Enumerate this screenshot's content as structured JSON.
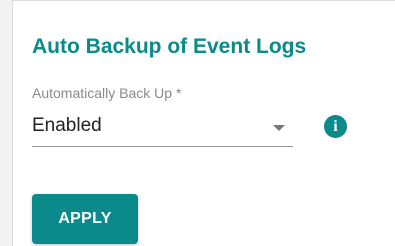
{
  "section": {
    "title": "Auto Backup of Event Logs"
  },
  "field": {
    "label": "Automatically Back Up *",
    "value": "Enabled"
  },
  "icons": {
    "dropdown": "chevron-down-icon",
    "info": "info-icon",
    "info_glyph": "i"
  },
  "actions": {
    "apply_label": "APPLY"
  },
  "colors": {
    "accent": "#0a8a8a"
  }
}
